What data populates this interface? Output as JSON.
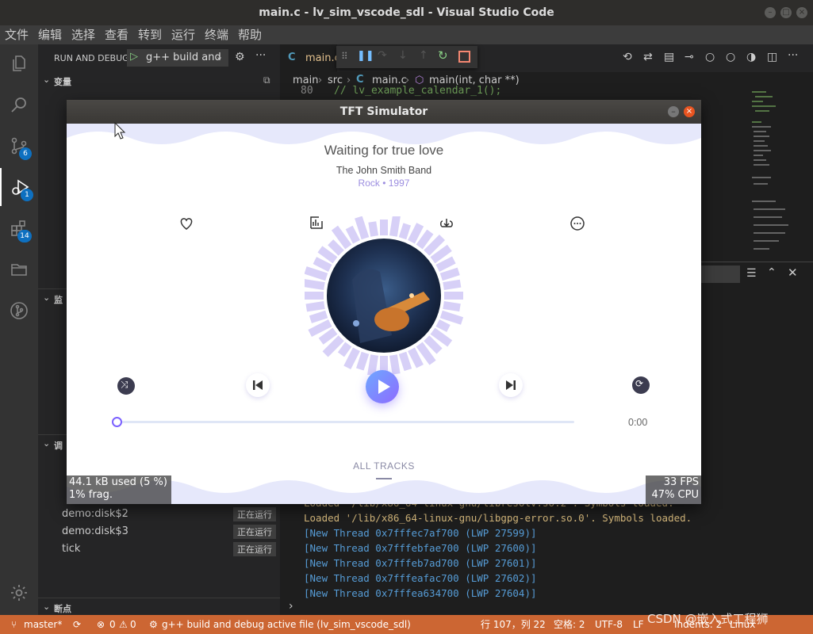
{
  "window": {
    "title": "main.c - lv_sim_vscode_sdl - Visual Studio Code"
  },
  "menu": [
    "文件",
    "编辑",
    "选择",
    "查看",
    "转到",
    "运行",
    "终端",
    "帮助"
  ],
  "activity": {
    "scm_badge": "6",
    "debug_badge": "1",
    "extensions_badge": "14"
  },
  "sidebar": {
    "header": "RUN AND DEBUG",
    "config_label": "g++ build and",
    "variables_title": "变量",
    "watch_title": "监",
    "callstack_title": "调",
    "breakpoints_title": "断点",
    "threads": [
      {
        "name": "demo:disk$2",
        "status": "正在运行"
      },
      {
        "name": "demo:disk$3",
        "status": "正在运行"
      },
      {
        "name": "tick",
        "status": "正在运行"
      }
    ]
  },
  "tabs": {
    "active": "main.c"
  },
  "breadcrumb": {
    "part1": "main",
    "part2": "src",
    "file": "main.c",
    "symbol": "main(int, char **)"
  },
  "editor": {
    "line_no": "80",
    "line_text": "//  lv_example_calendar_1();"
  },
  "terminal": {
    "lines": [
      {
        "text": "Loaded '/lib/x86_64-linux-gnu/libresolv.so.2'. Symbols loaded.",
        "color": "#d7ba7d"
      },
      {
        "text": "Loaded '/lib/x86_64-linux-gnu/libgpg-error.so.0'. Symbols loaded.",
        "color": "#d7ba7d"
      },
      {
        "text": "[New Thread 0x7fffec7af700 (LWP 27599)]",
        "color": "#569cd6"
      },
      {
        "text": "[New Thread 0x7fffebfae700 (LWP 27600)]",
        "color": "#569cd6"
      },
      {
        "text": "[New Thread 0x7fffeb7ad700 (LWP 27601)]",
        "color": "#569cd6"
      },
      {
        "text": "[New Thread 0x7fffeafac700 (LWP 27602)]",
        "color": "#569cd6"
      },
      {
        "text": "[New Thread 0x7fffea634700 (LWP 27604)]",
        "color": "#569cd6"
      }
    ]
  },
  "statusbar": {
    "branch": "master*",
    "problems": "0",
    "warnings": "0",
    "debug_config": "g++ build and debug active file (lv_sim_vscode_sdl)",
    "position": "行 107，列 22",
    "spaces": "空格: 2",
    "encoding": "UTF-8",
    "eol": "LF",
    "indents": "Indents: 2",
    "os": "Linux"
  },
  "watermark": "CSDN @嵌入式工程狮",
  "simulator": {
    "title": "TFT Simulator",
    "song_title": "Waiting for true love",
    "artist": "The John Smith Band",
    "genre_year": "Rock • 1997",
    "time": "0:00",
    "progress": 0,
    "all_tracks": "ALL TRACKS",
    "mem_used": "44.1 kB used (5 %)",
    "mem_frag": "1% frag.",
    "fps": "33 FPS",
    "cpu": "47% CPU",
    "accent": "#7b61ff"
  }
}
